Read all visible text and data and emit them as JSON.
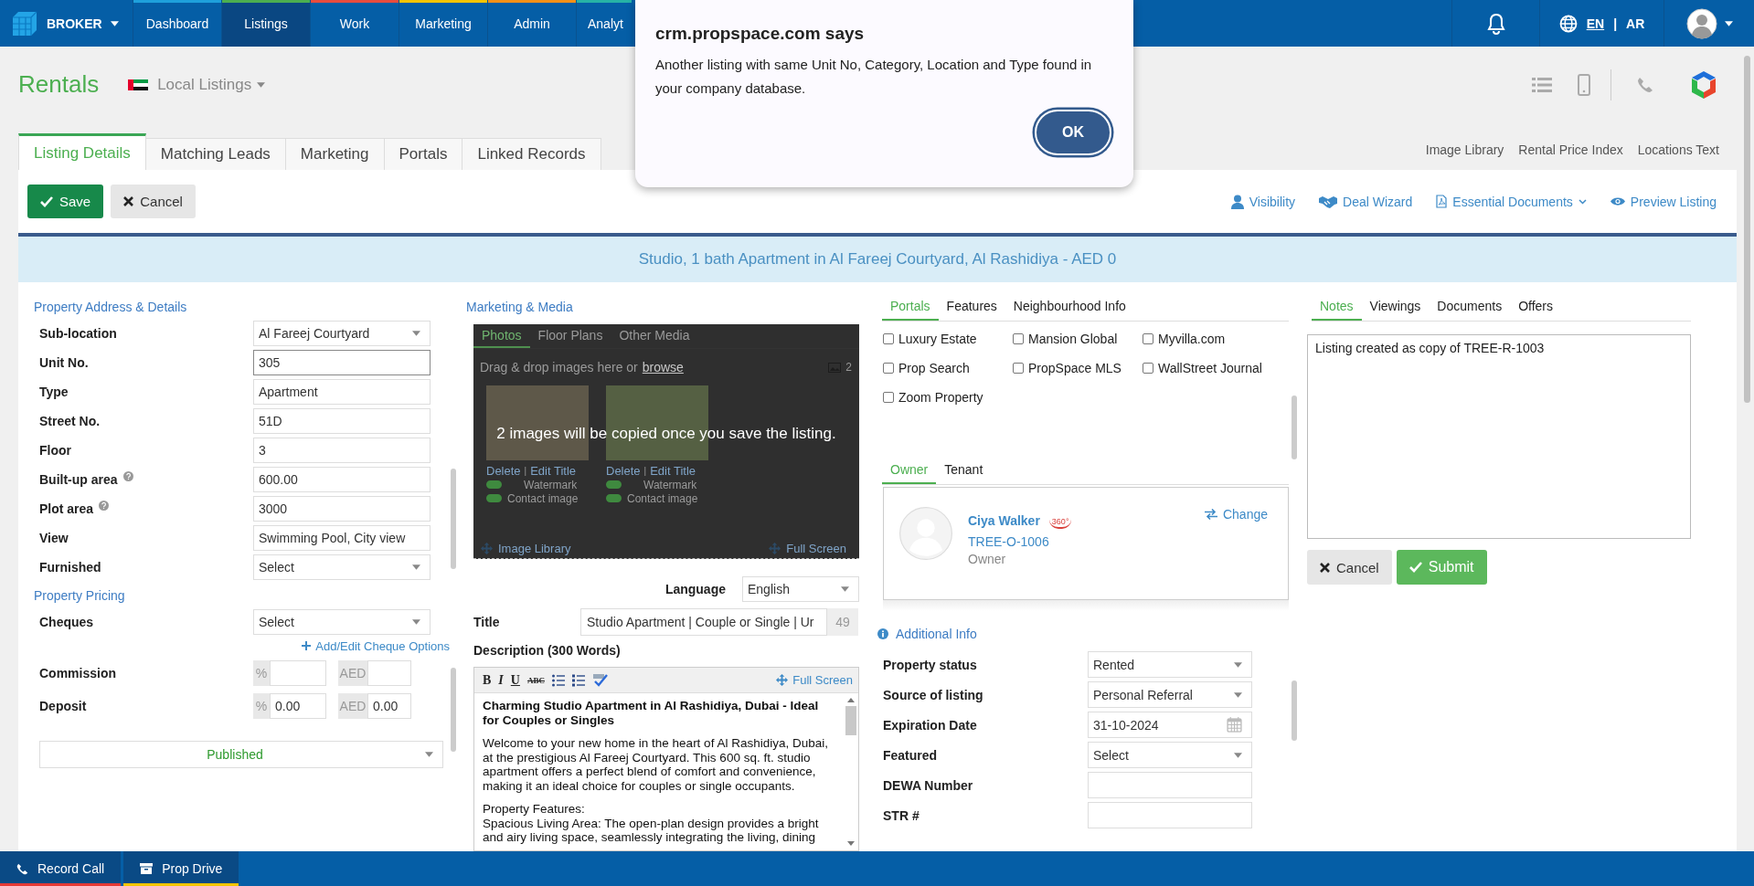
{
  "top_nav": {
    "brand": "BROKER",
    "items": [
      {
        "label": "Dashboard",
        "selected": false,
        "color": "#1ea0dc"
      },
      {
        "label": "Listings",
        "selected": true,
        "color": "#4caf50"
      },
      {
        "label": "Work",
        "selected": false,
        "color": "#e84c3d"
      },
      {
        "label": "Marketing",
        "selected": false,
        "color": "#f5c400"
      },
      {
        "label": "Admin",
        "selected": false,
        "color": "#f39018"
      },
      {
        "label": "Analyt",
        "selected": false,
        "color": "#26b3a6"
      }
    ],
    "languages": [
      {
        "label": "EN",
        "selected": true
      },
      {
        "label": "AR",
        "selected": false
      }
    ],
    "language_separator": "|"
  },
  "dialog": {
    "title": "crm.propspace.com says",
    "message": "Another listing with same Unit No, Category, Location and Type found in your company database.",
    "button": "OK"
  },
  "page_header": {
    "title": "Rentals",
    "scope": "Local Listings"
  },
  "tabs": [
    {
      "label": "Listing Details",
      "selected": true
    },
    {
      "label": "Matching Leads",
      "selected": false
    },
    {
      "label": "Marketing",
      "selected": false
    },
    {
      "label": "Portals",
      "selected": false
    },
    {
      "label": "Linked Records",
      "selected": false
    }
  ],
  "side_links": [
    "Image Library",
    "Rental Price Index",
    "Locations Text"
  ],
  "toolbar": {
    "buttons": [
      {
        "label": "Save",
        "kind": "primary"
      },
      {
        "label": "Cancel",
        "kind": "secondary"
      }
    ],
    "links": [
      {
        "label": "Visibility",
        "kind": "visibility"
      },
      {
        "label": "Deal Wizard",
        "kind": "deal"
      },
      {
        "label": "Essential Documents",
        "kind": "documents"
      },
      {
        "label": "Preview Listing",
        "kind": "preview"
      }
    ]
  },
  "banner": "Studio, 1 bath Apartment in Al Fareej Courtyard, Al Rashidiya - AED 0",
  "address_section": {
    "heading": "Property Address & Details",
    "fields": [
      {
        "label": "Sub-location",
        "value": "Al Fareej Courtyard",
        "kind": "select",
        "help": false,
        "focused": false
      },
      {
        "label": "Unit No.",
        "value": "305",
        "kind": "text",
        "help": false,
        "focused": true
      },
      {
        "label": "Type",
        "value": "Apartment",
        "kind": "text",
        "help": false,
        "focused": false
      },
      {
        "label": "Street No.",
        "value": "51D",
        "kind": "text",
        "help": false,
        "focused": false
      },
      {
        "label": "Floor",
        "value": "3",
        "kind": "text",
        "help": false,
        "focused": false
      },
      {
        "label": "Built-up area",
        "value": "600.00",
        "kind": "text",
        "help": true,
        "focused": false
      },
      {
        "label": "Plot area",
        "value": "3000",
        "kind": "text",
        "help": true,
        "focused": false
      },
      {
        "label": "View",
        "value": "Swimming Pool, City view",
        "kind": "text",
        "help": false,
        "focused": false
      },
      {
        "label": "Furnished",
        "value": "Select",
        "kind": "select",
        "help": false,
        "focused": false
      }
    ]
  },
  "pricing_section": {
    "heading": "Property Pricing",
    "cheques": {
      "label": "Cheques",
      "value": "Select"
    },
    "cheque_link": "Add/Edit Cheque Options",
    "rows": [
      {
        "label": "Commission",
        "inputs": [
          {
            "unit": "%"
          },
          {
            "unit": "AED"
          }
        ]
      },
      {
        "label": "Deposit",
        "inputs": [
          {
            "unit": "%",
            "value": "0.00"
          },
          {
            "unit": "AED",
            "value": "0.00"
          }
        ]
      }
    ],
    "status": "Published"
  },
  "media_section": {
    "heading": "Marketing & Media",
    "tabs": [
      {
        "label": "Photos",
        "selected": true
      },
      {
        "label": "Floor Plans",
        "selected": false
      },
      {
        "label": "Other Media",
        "selected": false
      }
    ],
    "drop_text": "Drag & drop images here or",
    "browse_link": "browse",
    "image_count": "2",
    "images": [
      {
        "actions": [
          "Delete",
          "Edit Title"
        ],
        "separator": "|",
        "toggles": [
          {
            "label": "Watermark",
            "on": true
          },
          {
            "label": "Contact image",
            "on": true
          }
        ]
      },
      {
        "actions": [
          "Delete",
          "Edit Title"
        ],
        "separator": "|",
        "toggles": [
          {
            "label": "Watermark",
            "on": true
          },
          {
            "label": "Contact image",
            "on": true
          }
        ]
      }
    ],
    "footer_links": [
      "Image Library",
      "Full Screen"
    ],
    "overlay_message": "2 images will be copied once you save the listing.",
    "language": {
      "label": "Language",
      "value": "English"
    },
    "title": {
      "label": "Title",
      "value": "Studio Apartment | Couple or Single | Ur",
      "count": "49"
    },
    "description": {
      "label": "Description (300 Words)",
      "format_buttons": [
        {
          "kind": "bold",
          "glyph": "B"
        },
        {
          "kind": "italic",
          "glyph": "I"
        },
        {
          "kind": "underline",
          "glyph": "U"
        },
        {
          "kind": "strike",
          "glyph": "ABC"
        },
        {
          "kind": "bullets"
        },
        {
          "kind": "numbers"
        },
        {
          "kind": "spellcheck"
        }
      ],
      "full_screen": "Full Screen",
      "heading": "Charming Studio Apartment in Al Rashidiya, Dubai - Ideal for Couples or Singles",
      "paragraphs": [
        [
          "Welcome to your new home in the heart of Al Rashidiya, Dubai, at the prestigious Al Fareej Courtyard. This 600 sq. ft. studio apartment offers a perfect blend of comfort and convenience, making it an ideal choice for couples or single occupants."
        ],
        [
          "Property Features:",
          "Spacious Living Area: The open-plan design provides a bright and airy living space, seamlessly integrating the living, dining"
        ]
      ]
    }
  },
  "portals_section": {
    "tabs": [
      {
        "label": "Portals",
        "selected": true
      },
      {
        "label": "Features",
        "selected": false
      },
      {
        "label": "Neighbourhood Info",
        "selected": false
      }
    ],
    "options": [
      {
        "label": "Luxury Estate",
        "checked": false
      },
      {
        "label": "Mansion Global",
        "checked": false
      },
      {
        "label": "Myvilla.com",
        "checked": false
      },
      {
        "label": "Prop Search",
        "checked": false
      },
      {
        "label": "PropSpace MLS",
        "checked": false
      },
      {
        "label": "WallStreet Journal",
        "checked": false
      },
      {
        "label": "Zoom Property",
        "checked": false
      }
    ]
  },
  "contacts": {
    "tabs": [
      {
        "label": "Owner",
        "selected": true
      },
      {
        "label": "Tenant",
        "selected": false
      }
    ],
    "card": {
      "name": "Ciya Walker",
      "badge": "360°",
      "change": "Change",
      "reference": "TREE-O-1006",
      "role": "Owner"
    }
  },
  "additional_info": {
    "heading": "Additional Info",
    "fields": [
      {
        "label": "Property status",
        "value": "Rented",
        "kind": "select"
      },
      {
        "label": "Source of listing",
        "value": "Personal Referral",
        "kind": "select"
      },
      {
        "label": "Expiration Date",
        "value": "31-10-2024",
        "kind": "date"
      },
      {
        "label": "Featured",
        "value": "Select",
        "kind": "select"
      },
      {
        "label": "DEWA Number",
        "kind": "text"
      },
      {
        "label": "STR #",
        "kind": "text"
      }
    ]
  },
  "notes_section": {
    "tabs": [
      {
        "label": "Notes",
        "selected": true
      },
      {
        "label": "Viewings",
        "selected": false
      },
      {
        "label": "Documents",
        "selected": false
      },
      {
        "label": "Offers",
        "selected": false
      }
    ],
    "text": "Listing created as copy of TREE-R-1003",
    "buttons": [
      {
        "label": "Cancel",
        "kind": "secondary"
      },
      {
        "label": "Submit",
        "kind": "success"
      }
    ]
  },
  "footer": {
    "buttons": [
      {
        "label": "Record Call",
        "kind": "call",
        "color": "#e53935"
      },
      {
        "label": "Prop Drive",
        "kind": "drive",
        "color": "#f5c400"
      }
    ]
  }
}
